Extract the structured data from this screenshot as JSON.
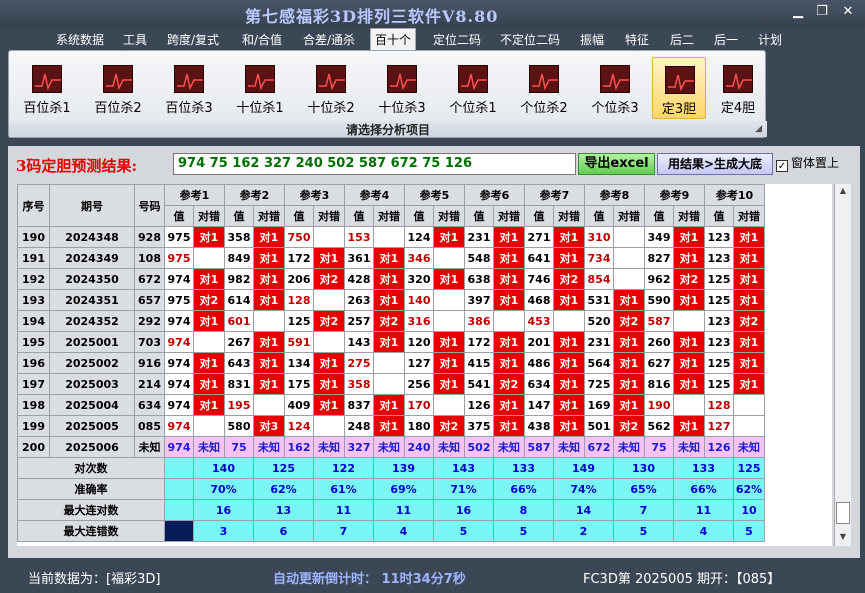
{
  "window": {
    "title": "第七感福彩3D排列三软件V8.80",
    "controls": [
      "minimize",
      "restore",
      "close"
    ]
  },
  "menu": [
    "系统数据",
    "工具",
    "跨度/复式",
    "和/合值",
    "合差/通杀",
    "百十个",
    "定位二码",
    "不定位二码",
    "振幅",
    "特征",
    "后二",
    "后一",
    "计划"
  ],
  "active_menu": "百十个",
  "ribbon": {
    "buttons": [
      "百位杀1",
      "百位杀2",
      "百位杀3",
      "十位杀1",
      "十位杀2",
      "十位杀3",
      "个位杀1",
      "个位杀2",
      "个位杀3",
      "定3胆",
      "定4胆"
    ],
    "selected": "定3胆",
    "caption": "请选择分析项目"
  },
  "result": {
    "label": "3码定胆预测结果:",
    "value": "974  75  162  327  240  502  587  672  75  126",
    "export_button": "导出excel",
    "generate_button": "用结果>生成大底",
    "ontop_label": "窗体置上",
    "ontop_checked": true
  },
  "table": {
    "col_headers": {
      "seq": "序号",
      "period": "期号",
      "number": "号码"
    },
    "ref_headers": [
      "参考1",
      "参考2",
      "参考3",
      "参考4",
      "参考5",
      "参考6",
      "参考7",
      "参考8",
      "参考9",
      "参考10"
    ],
    "sub_headers": {
      "value": "值",
      "check": "对错"
    },
    "rows": [
      {
        "seq": "190",
        "period": "2024348",
        "number": "928",
        "refs": [
          [
            "975",
            1,
            "对1"
          ],
          [
            "358",
            1,
            "对1"
          ],
          [
            "750",
            1,
            ""
          ],
          [
            "153",
            1,
            ""
          ],
          [
            "124",
            1,
            "对1"
          ],
          [
            "231",
            1,
            "对1"
          ],
          [
            "271",
            1,
            "对1"
          ],
          [
            "310",
            1,
            ""
          ],
          [
            "349",
            1,
            "对1"
          ],
          [
            "123",
            1,
            "对1"
          ]
        ]
      },
      {
        "seq": "191",
        "period": "2024349",
        "number": "108",
        "refs": [
          [
            "975",
            0,
            ""
          ],
          [
            "849",
            1,
            "对1"
          ],
          [
            "172",
            1,
            "对1"
          ],
          [
            "361",
            1,
            "对1"
          ],
          [
            "346",
            1,
            ""
          ],
          [
            "548",
            1,
            "对1"
          ],
          [
            "641",
            1,
            "对1"
          ],
          [
            "734",
            1,
            ""
          ],
          [
            "827",
            1,
            "对1"
          ],
          [
            "123",
            1,
            "对1"
          ]
        ]
      },
      {
        "seq": "192",
        "period": "2024350",
        "number": "672",
        "refs": [
          [
            "974",
            1,
            "对1"
          ],
          [
            "982",
            1,
            "对1"
          ],
          [
            "206",
            1,
            "对2"
          ],
          [
            "428",
            1,
            "对1"
          ],
          [
            "320",
            1,
            "对1"
          ],
          [
            "638",
            1,
            "对1"
          ],
          [
            "746",
            1,
            "对2"
          ],
          [
            "854",
            1,
            ""
          ],
          [
            "962",
            1,
            "对2"
          ],
          [
            "125",
            1,
            "对1"
          ]
        ]
      },
      {
        "seq": "193",
        "period": "2024351",
        "number": "657",
        "refs": [
          [
            "975",
            1,
            "对2"
          ],
          [
            "614",
            1,
            "对1"
          ],
          [
            "128",
            1,
            ""
          ],
          [
            "263",
            1,
            "对1"
          ],
          [
            "140",
            1,
            ""
          ],
          [
            "397",
            1,
            "对1"
          ],
          [
            "468",
            1,
            "对1"
          ],
          [
            "531",
            1,
            "对1"
          ],
          [
            "590",
            1,
            "对1"
          ],
          [
            "125",
            1,
            "对1"
          ]
        ]
      },
      {
        "seq": "194",
        "period": "2024352",
        "number": "292",
        "refs": [
          [
            "974",
            1,
            "对1"
          ],
          [
            "601",
            1,
            ""
          ],
          [
            "125",
            1,
            "对2"
          ],
          [
            "257",
            1,
            "对2"
          ],
          [
            "316",
            1,
            ""
          ],
          [
            "386",
            1,
            ""
          ],
          [
            "453",
            1,
            ""
          ],
          [
            "520",
            1,
            "对2"
          ],
          [
            "587",
            1,
            ""
          ],
          [
            "123",
            1,
            "对2"
          ]
        ]
      },
      {
        "seq": "195",
        "period": "2025001",
        "number": "703",
        "refs": [
          [
            "974",
            0,
            ""
          ],
          [
            "267",
            1,
            "对1"
          ],
          [
            "591",
            1,
            ""
          ],
          [
            "143",
            1,
            "对1"
          ],
          [
            "120",
            1,
            "对1"
          ],
          [
            "172",
            1,
            "对1"
          ],
          [
            "201",
            1,
            "对1"
          ],
          [
            "231",
            1,
            "对1"
          ],
          [
            "260",
            1,
            "对1"
          ],
          [
            "123",
            1,
            "对1"
          ]
        ]
      },
      {
        "seq": "196",
        "period": "2025002",
        "number": "916",
        "refs": [
          [
            "974",
            1,
            "对1"
          ],
          [
            "643",
            1,
            "对1"
          ],
          [
            "134",
            1,
            "对1"
          ],
          [
            "275",
            1,
            ""
          ],
          [
            "127",
            1,
            "对1"
          ],
          [
            "415",
            1,
            "对1"
          ],
          [
            "486",
            1,
            "对1"
          ],
          [
            "564",
            1,
            "对1"
          ],
          [
            "627",
            1,
            "对1"
          ],
          [
            "125",
            1,
            "对1"
          ]
        ]
      },
      {
        "seq": "197",
        "period": "2025003",
        "number": "214",
        "refs": [
          [
            "974",
            1,
            "对1"
          ],
          [
            "831",
            1,
            "对1"
          ],
          [
            "175",
            1,
            "对1"
          ],
          [
            "358",
            1,
            ""
          ],
          [
            "256",
            1,
            "对1"
          ],
          [
            "541",
            1,
            "对2"
          ],
          [
            "634",
            1,
            "对1"
          ],
          [
            "725",
            1,
            "对1"
          ],
          [
            "816",
            1,
            "对1"
          ],
          [
            "125",
            1,
            "对1"
          ]
        ]
      },
      {
        "seq": "198",
        "period": "2025004",
        "number": "634",
        "refs": [
          [
            "974",
            1,
            "对1"
          ],
          [
            "195",
            1,
            ""
          ],
          [
            "409",
            1,
            "对1"
          ],
          [
            "837",
            1,
            "对1"
          ],
          [
            "170",
            1,
            ""
          ],
          [
            "126",
            1,
            "对1"
          ],
          [
            "147",
            1,
            "对1"
          ],
          [
            "169",
            1,
            "对1"
          ],
          [
            "190",
            1,
            ""
          ],
          [
            "128",
            1,
            ""
          ]
        ]
      },
      {
        "seq": "199",
        "period": "2025005",
        "number": "085",
        "refs": [
          [
            "974",
            0,
            ""
          ],
          [
            "580",
            1,
            "对3"
          ],
          [
            "124",
            1,
            ""
          ],
          [
            "248",
            1,
            "对1"
          ],
          [
            "180",
            1,
            "对2"
          ],
          [
            "375",
            1,
            "对1"
          ],
          [
            "438",
            1,
            "对1"
          ],
          [
            "501",
            1,
            "对2"
          ],
          [
            "562",
            1,
            "对1"
          ],
          [
            "127",
            1,
            ""
          ]
        ]
      }
    ],
    "pending_row": {
      "seq": "200",
      "period": "2025006",
      "number": "未知",
      "values": [
        "974",
        "75",
        "162",
        "327",
        "240",
        "502",
        "587",
        "672",
        "75",
        "126"
      ],
      "status": "未知"
    },
    "stats": [
      {
        "label": "对次数",
        "values": [
          "140",
          "125",
          "122",
          "139",
          "143",
          "133",
          "149",
          "130",
          "133",
          "125"
        ]
      },
      {
        "label": "准确率",
        "values": [
          "70%",
          "62%",
          "61%",
          "69%",
          "71%",
          "66%",
          "74%",
          "65%",
          "66%",
          "62%"
        ]
      },
      {
        "label": "最大连对数",
        "values": [
          "16",
          "13",
          "11",
          "11",
          "16",
          "8",
          "14",
          "7",
          "11",
          "10"
        ]
      },
      {
        "label": "最大连错数",
        "values": [
          "3",
          "6",
          "7",
          "4",
          "5",
          "5",
          "2",
          "5",
          "4",
          "5"
        ]
      }
    ]
  },
  "status": {
    "left": "当前数据为：[福彩3D]",
    "middle": "自动更新倒计时：  11时34分7秒",
    "right": "FC3D第 2025005 期开：【085】"
  }
}
